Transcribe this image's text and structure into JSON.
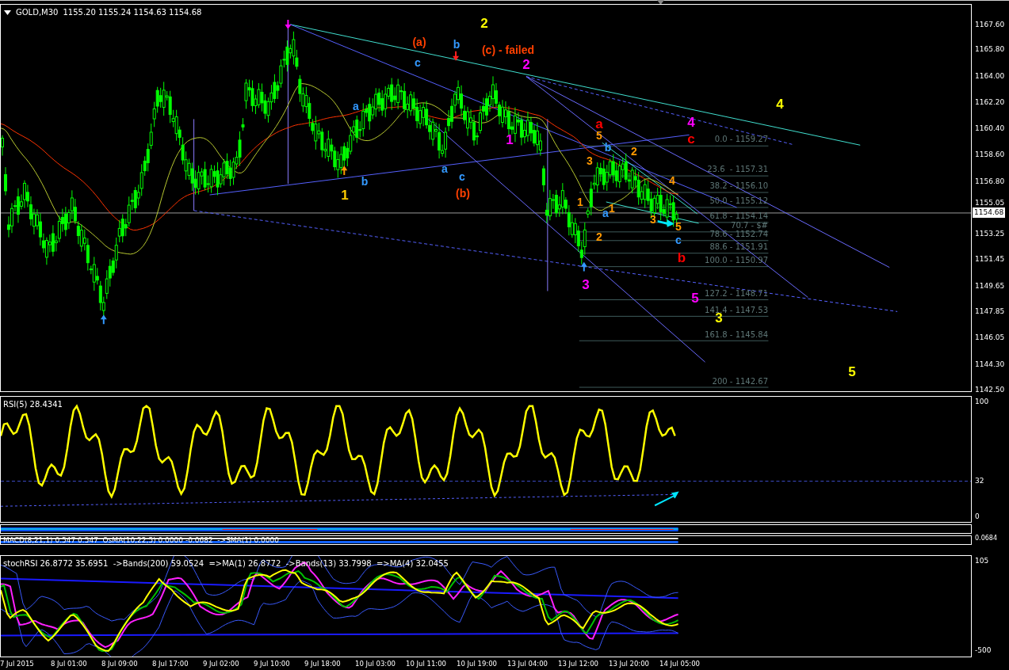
{
  "chart_header": {
    "symbol": "GOLD,M30",
    "quote": "1155.20 1155.24 1154.63 1154.68"
  },
  "price_axis": {
    "ticks": [
      "1167.60",
      "1165.80",
      "1164.00",
      "1162.20",
      "1160.40",
      "1158.60",
      "1156.80",
      "1155.05",
      "1153.25",
      "1151.45",
      "1149.65",
      "1147.85",
      "1146.05",
      "1144.30",
      "1142.50"
    ],
    "current_price": "1154.68"
  },
  "wave_labels": [
    {
      "text": "2",
      "color": "#ffff00"
    },
    {
      "text": "(a)",
      "color": "#ff4000"
    },
    {
      "text": "b",
      "color": "#3399ff"
    },
    {
      "text": "(c) - failed",
      "color": "#ff4000"
    },
    {
      "text": "2",
      "color": "#ff00ff"
    },
    {
      "text": "c",
      "color": "#3399ff"
    },
    {
      "text": "a",
      "color": "#3399ff"
    },
    {
      "text": "1",
      "color": "#ff00ff"
    },
    {
      "text": "a",
      "color": "#ff0000"
    },
    {
      "text": "4",
      "color": "#ff00ff"
    },
    {
      "text": "c",
      "color": "#ff0000"
    },
    {
      "text": "4",
      "color": "#ffff00"
    },
    {
      "text": "5",
      "color": "#ff9900"
    },
    {
      "text": "b",
      "color": "#3399ff"
    },
    {
      "text": "2",
      "color": "#ff9900"
    },
    {
      "text": "3",
      "color": "#ff9900"
    },
    {
      "text": "4",
      "color": "#ff9900"
    },
    {
      "text": "1",
      "color": "#ffcc00"
    },
    {
      "text": "b",
      "color": "#3399ff"
    },
    {
      "text": "a",
      "color": "#3399ff"
    },
    {
      "text": "c",
      "color": "#3399ff"
    },
    {
      "text": "(b)",
      "color": "#ff4000"
    },
    {
      "text": "1",
      "color": "#ff9900"
    },
    {
      "text": "1",
      "color": "#ff9900"
    },
    {
      "text": "a",
      "color": "#3399ff"
    },
    {
      "text": "2",
      "color": "#ff9900"
    },
    {
      "text": "3",
      "color": "#ff9900"
    },
    {
      "text": "5",
      "color": "#ff9900"
    },
    {
      "text": "c",
      "color": "#3399ff"
    },
    {
      "text": "b",
      "color": "#ff0000"
    },
    {
      "text": "3",
      "color": "#ff00ff"
    },
    {
      "text": "5",
      "color": "#ff00ff"
    },
    {
      "text": "3",
      "color": "#ffff00"
    },
    {
      "text": "5",
      "color": "#ffff00"
    }
  ],
  "fib_levels": [
    "0.0 - 1159.27",
    "23.6  - 1157.31",
    "38.2 - 1156.10",
    "50.0 - 1155.12",
    "61.8 - 1154.14",
    "70.7 - $#",
    "78.6 - 1152.74",
    "88.6 - 1151.91",
    "100.0 - 1150.97",
    "127.2 - 1148.71",
    "141.4 - 1147.53",
    "161.8 - 1145.84",
    "200 - 1142.67"
  ],
  "rsi_panel": {
    "header": "RSI(5) 28.4341",
    "axis": [
      "100",
      "32",
      "0"
    ]
  },
  "macd_panel": {
    "header": "MACD(8,21,1) 0.547 0.547  OsMA(10,22,5) 0.0000 -0.0682  ->SMA(1) 0.0000",
    "axis": "0.0684"
  },
  "stoch_panel": {
    "header": "stochRSI 26.8772 35.6951  ->Bands(200) 59.0524  =>MA(1) 26.8772  ->Bands(13) 33.7998  =>MA(4) 32.0455",
    "axis": [
      "105",
      "-500"
    ]
  },
  "time_axis": [
    "7 Jul 2015",
    "8 Jul 01:00",
    "8 Jul 09:00",
    "8 Jul 17:00",
    "9 Jul 02:00",
    "9 Jul 10:00",
    "9 Jul 18:00",
    "10 Jul 03:00",
    "10 Jul 11:00",
    "10 Jul 19:00",
    "13 Jul 04:00",
    "13 Jul 12:00",
    "13 Jul 20:00",
    "14 Jul 05:00"
  ]
}
